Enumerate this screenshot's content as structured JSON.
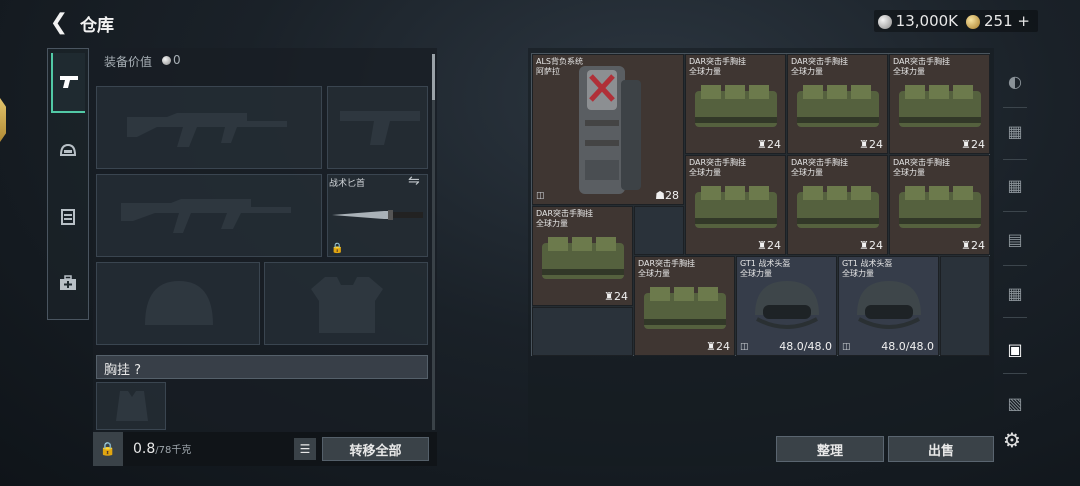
{
  "header": {
    "title": "仓库",
    "silver": "13,000K",
    "gold": "251",
    "gold_plus": "+"
  },
  "equipment": {
    "value_label": "装备价值",
    "value": "0",
    "knife_label": "战术匕首",
    "chest_label": "胸挂",
    "chest_help": "?"
  },
  "bottom": {
    "weight": "0.8",
    "weight_max": "/78千克",
    "transfer_label": "转移全部"
  },
  "inventory": {
    "items": [
      {
        "name1": "ALS背负系统",
        "name2": "阿萨拉",
        "qty": "28",
        "qty_icon": "☗",
        "type": "backpack"
      },
      {
        "name1": "DAR突击手胸挂",
        "name2": "全球力量",
        "qty": "24",
        "qty_icon": "♜",
        "type": "rig"
      },
      {
        "name1": "DAR突击手胸挂",
        "name2": "全球力量",
        "qty": "24",
        "qty_icon": "♜",
        "type": "rig"
      },
      {
        "name1": "DAR突击手胸挂",
        "name2": "全球力量",
        "qty": "24",
        "qty_icon": "♜",
        "type": "rig"
      },
      {
        "name1": "DAR突击手胸挂",
        "name2": "全球力量",
        "qty": "24",
        "qty_icon": "♜",
        "type": "rig"
      },
      {
        "name1": "DAR突击手胸挂",
        "name2": "全球力量",
        "qty": "24",
        "qty_icon": "♜",
        "type": "rig"
      },
      {
        "name1": "DAR突击手胸挂",
        "name2": "全球力量",
        "qty": "24",
        "qty_icon": "♜",
        "type": "rig"
      },
      {
        "name1": "DAR突击手胸挂",
        "name2": "全球力量",
        "qty": "24",
        "qty_icon": "♜",
        "type": "rig"
      },
      {
        "name1": "DAR突击手胸挂",
        "name2": "全球力量",
        "qty": "24",
        "qty_icon": "♜",
        "type": "rig"
      },
      {
        "name1": "GT1 战术头盔",
        "name2": "全球力量",
        "qty": "48.0/48.0",
        "qty_icon": "",
        "type": "helmet"
      },
      {
        "name1": "GT1 战术头盔",
        "name2": "全球力量",
        "qty": "48.0/48.0",
        "qty_icon": "",
        "type": "helmet"
      }
    ],
    "sort_label": "整理",
    "sell_label": "出售"
  },
  "icons": {
    "back": "back-arrow-icon",
    "weapon_tab": "pistol-icon",
    "helmet_tab": "helmet-icon",
    "vest_tab": "vest-icon",
    "medkit_tab": "medkit-icon",
    "settings": "gear-icon"
  },
  "colors": {
    "accent": "#52c9a6",
    "gold": "#d8b45a"
  }
}
